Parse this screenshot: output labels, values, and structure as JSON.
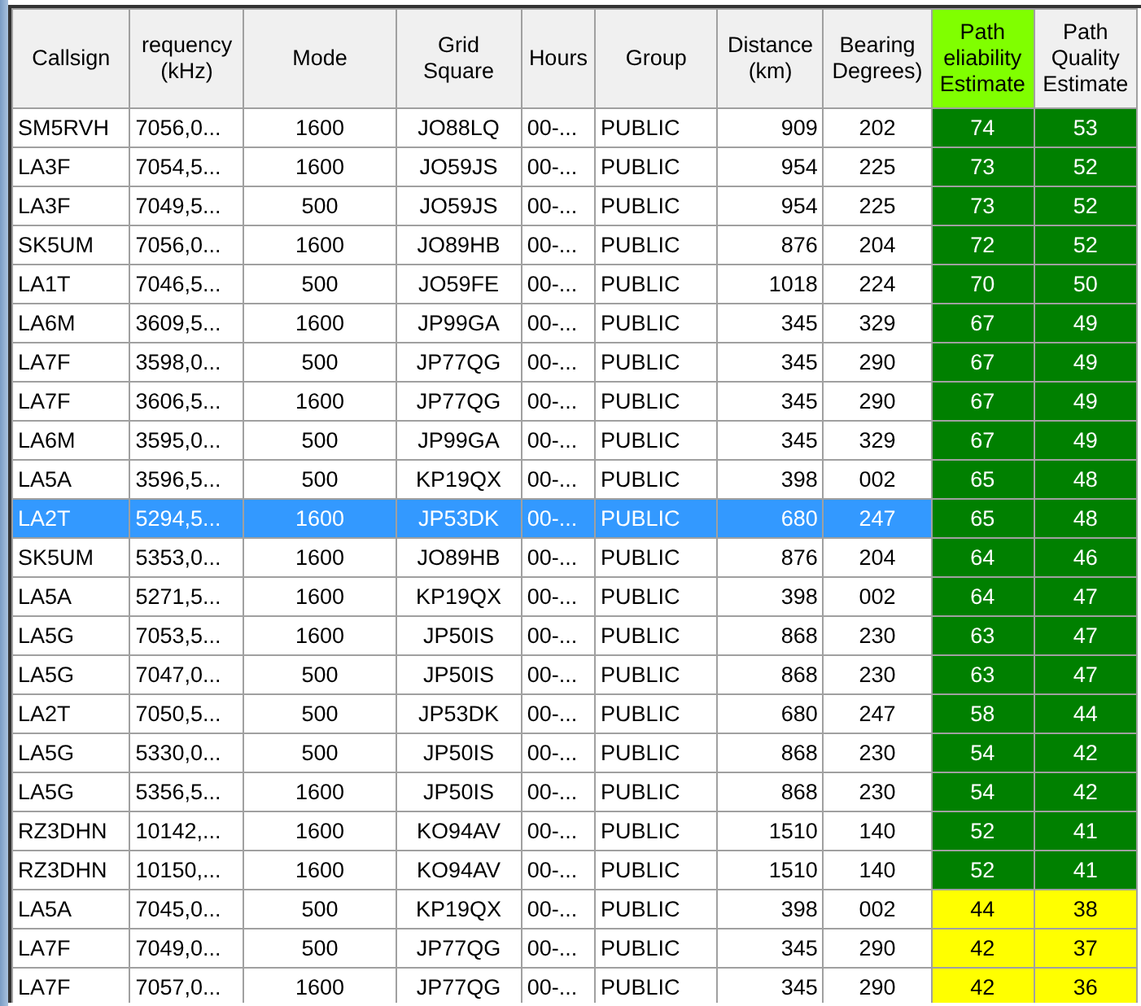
{
  "table": {
    "columns": [
      {
        "label": "Callsign",
        "kind": "text"
      },
      {
        "label": "requency (kHz)",
        "kind": "text"
      },
      {
        "label": "Mode",
        "kind": "code"
      },
      {
        "label": "Grid Square",
        "kind": "code"
      },
      {
        "label": "Hours",
        "kind": "text"
      },
      {
        "label": "Group",
        "kind": "text"
      },
      {
        "label": "Distance (km)",
        "kind": "number"
      },
      {
        "label": "Bearing Degrees)",
        "kind": "code"
      },
      {
        "label": "Path eliability Estimate",
        "kind": "rating",
        "color": "#80ff00"
      },
      {
        "label": "Path Quality Estimate",
        "kind": "rating"
      }
    ],
    "rows": [
      {
        "selected": false,
        "cells": [
          "SM5RVH",
          "7056,0...",
          "1600",
          "JO88LQ",
          "00-...",
          "PUBLIC",
          "909",
          "202"
        ],
        "ratings": [
          {
            "value": "74",
            "color": "#008000"
          },
          {
            "value": "53",
            "color": "#008000"
          }
        ]
      },
      {
        "selected": false,
        "cells": [
          "LA3F",
          "7054,5...",
          "1600",
          "JO59JS",
          "00-...",
          "PUBLIC",
          "954",
          "225"
        ],
        "ratings": [
          {
            "value": "73",
            "color": "#008000"
          },
          {
            "value": "52",
            "color": "#008000"
          }
        ]
      },
      {
        "selected": false,
        "cells": [
          "LA3F",
          "7049,5...",
          "500",
          "JO59JS",
          "00-...",
          "PUBLIC",
          "954",
          "225"
        ],
        "ratings": [
          {
            "value": "73",
            "color": "#008000"
          },
          {
            "value": "52",
            "color": "#008000"
          }
        ]
      },
      {
        "selected": false,
        "cells": [
          "SK5UM",
          "7056,0...",
          "1600",
          "JO89HB",
          "00-...",
          "PUBLIC",
          "876",
          "204"
        ],
        "ratings": [
          {
            "value": "72",
            "color": "#008000"
          },
          {
            "value": "52",
            "color": "#008000"
          }
        ]
      },
      {
        "selected": false,
        "cells": [
          "LA1T",
          "7046,5...",
          "500",
          "JO59FE",
          "00-...",
          "PUBLIC",
          "1018",
          "224"
        ],
        "ratings": [
          {
            "value": "70",
            "color": "#008000"
          },
          {
            "value": "50",
            "color": "#008000"
          }
        ]
      },
      {
        "selected": false,
        "cells": [
          "LA6M",
          "3609,5...",
          "1600",
          "JP99GA",
          "00-...",
          "PUBLIC",
          "345",
          "329"
        ],
        "ratings": [
          {
            "value": "67",
            "color": "#008000"
          },
          {
            "value": "49",
            "color": "#008000"
          }
        ]
      },
      {
        "selected": false,
        "cells": [
          "LA7F",
          "3598,0...",
          "500",
          "JP77QG",
          "00-...",
          "PUBLIC",
          "345",
          "290"
        ],
        "ratings": [
          {
            "value": "67",
            "color": "#008000"
          },
          {
            "value": "49",
            "color": "#008000"
          }
        ]
      },
      {
        "selected": false,
        "cells": [
          "LA7F",
          "3606,5...",
          "1600",
          "JP77QG",
          "00-...",
          "PUBLIC",
          "345",
          "290"
        ],
        "ratings": [
          {
            "value": "67",
            "color": "#008000"
          },
          {
            "value": "49",
            "color": "#008000"
          }
        ]
      },
      {
        "selected": false,
        "cells": [
          "LA6M",
          "3595,0...",
          "500",
          "JP99GA",
          "00-...",
          "PUBLIC",
          "345",
          "329"
        ],
        "ratings": [
          {
            "value": "67",
            "color": "#008000"
          },
          {
            "value": "49",
            "color": "#008000"
          }
        ]
      },
      {
        "selected": false,
        "cells": [
          "LA5A",
          "3596,5...",
          "500",
          "KP19QX",
          "00-...",
          "PUBLIC",
          "398",
          "002"
        ],
        "ratings": [
          {
            "value": "65",
            "color": "#008000"
          },
          {
            "value": "48",
            "color": "#008000"
          }
        ]
      },
      {
        "selected": true,
        "cells": [
          "LA2T",
          "5294,5...",
          "1600",
          "JP53DK",
          "00-...",
          "PUBLIC",
          "680",
          "247"
        ],
        "ratings": [
          {
            "value": "65",
            "color": "#008000"
          },
          {
            "value": "48",
            "color": "#008000"
          }
        ]
      },
      {
        "selected": false,
        "cells": [
          "SK5UM",
          "5353,0...",
          "1600",
          "JO89HB",
          "00-...",
          "PUBLIC",
          "876",
          "204"
        ],
        "ratings": [
          {
            "value": "64",
            "color": "#008000"
          },
          {
            "value": "46",
            "color": "#008000"
          }
        ]
      },
      {
        "selected": false,
        "cells": [
          "LA5A",
          "5271,5...",
          "1600",
          "KP19QX",
          "00-...",
          "PUBLIC",
          "398",
          "002"
        ],
        "ratings": [
          {
            "value": "64",
            "color": "#008000"
          },
          {
            "value": "47",
            "color": "#008000"
          }
        ]
      },
      {
        "selected": false,
        "cells": [
          "LA5G",
          "7053,5...",
          "1600",
          "JP50IS",
          "00-...",
          "PUBLIC",
          "868",
          "230"
        ],
        "ratings": [
          {
            "value": "63",
            "color": "#008000"
          },
          {
            "value": "47",
            "color": "#008000"
          }
        ]
      },
      {
        "selected": false,
        "cells": [
          "LA5G",
          "7047,0...",
          "500",
          "JP50IS",
          "00-...",
          "PUBLIC",
          "868",
          "230"
        ],
        "ratings": [
          {
            "value": "63",
            "color": "#008000"
          },
          {
            "value": "47",
            "color": "#008000"
          }
        ]
      },
      {
        "selected": false,
        "cells": [
          "LA2T",
          "7050,5...",
          "500",
          "JP53DK",
          "00-...",
          "PUBLIC",
          "680",
          "247"
        ],
        "ratings": [
          {
            "value": "58",
            "color": "#008000"
          },
          {
            "value": "44",
            "color": "#008000"
          }
        ]
      },
      {
        "selected": false,
        "cells": [
          "LA5G",
          "5330,0...",
          "500",
          "JP50IS",
          "00-...",
          "PUBLIC",
          "868",
          "230"
        ],
        "ratings": [
          {
            "value": "54",
            "color": "#008000"
          },
          {
            "value": "42",
            "color": "#008000"
          }
        ]
      },
      {
        "selected": false,
        "cells": [
          "LA5G",
          "5356,5...",
          "1600",
          "JP50IS",
          "00-...",
          "PUBLIC",
          "868",
          "230"
        ],
        "ratings": [
          {
            "value": "54",
            "color": "#008000"
          },
          {
            "value": "42",
            "color": "#008000"
          }
        ]
      },
      {
        "selected": false,
        "cells": [
          "RZ3DHN",
          "10142,...",
          "1600",
          "KO94AV",
          "00-...",
          "PUBLIC",
          "1510",
          "140"
        ],
        "ratings": [
          {
            "value": "52",
            "color": "#008000"
          },
          {
            "value": "41",
            "color": "#008000"
          }
        ]
      },
      {
        "selected": false,
        "cells": [
          "RZ3DHN",
          "10150,...",
          "1600",
          "KO94AV",
          "00-...",
          "PUBLIC",
          "1510",
          "140"
        ],
        "ratings": [
          {
            "value": "52",
            "color": "#008000"
          },
          {
            "value": "41",
            "color": "#008000"
          }
        ]
      },
      {
        "selected": false,
        "cells": [
          "LA5A",
          "7045,0...",
          "500",
          "KP19QX",
          "00-...",
          "PUBLIC",
          "398",
          "002"
        ],
        "ratings": [
          {
            "value": "44",
            "color": "#ffff00"
          },
          {
            "value": "38",
            "color": "#ffff00"
          }
        ]
      },
      {
        "selected": false,
        "cells": [
          "LA7F",
          "7049,0...",
          "500",
          "JP77QG",
          "00-...",
          "PUBLIC",
          "345",
          "290"
        ],
        "ratings": [
          {
            "value": "42",
            "color": "#ffff00"
          },
          {
            "value": "37",
            "color": "#ffff00"
          }
        ]
      },
      {
        "selected": false,
        "cells": [
          "LA7F",
          "7057,0...",
          "1600",
          "JP77QG",
          "00-...",
          "PUBLIC",
          "345",
          "290"
        ],
        "ratings": [
          {
            "value": "42",
            "color": "#ffff00"
          },
          {
            "value": "36",
            "color": "#ffff00"
          }
        ]
      }
    ]
  }
}
